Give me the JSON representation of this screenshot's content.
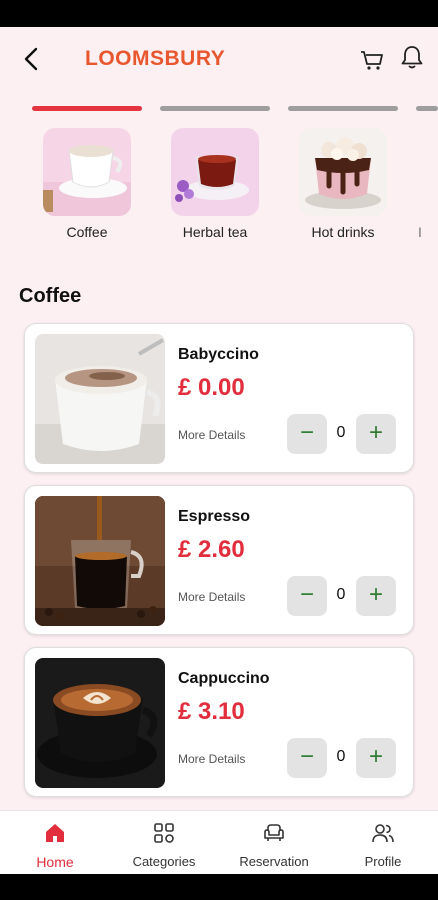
{
  "header": {
    "logo": "LOOMSBURY",
    "back_icon": "chevron-left-icon",
    "cart_icon": "cart-icon",
    "bell_icon": "bell-icon",
    "brand_color": "#e8572f"
  },
  "categories": [
    {
      "label": "Coffee",
      "active": true
    },
    {
      "label": "Herbal tea",
      "active": false
    },
    {
      "label": "Hot drinks",
      "active": false
    }
  ],
  "section": {
    "title": "Coffee"
  },
  "products": [
    {
      "name": "Babyccino",
      "price": "£ 0.00",
      "more": "More Details",
      "qty": "0"
    },
    {
      "name": "Espresso",
      "price": "£ 2.60",
      "more": "More Details",
      "qty": "0"
    },
    {
      "name": "Cappuccino",
      "price": "£ 3.10",
      "more": "More Details",
      "qty": "0"
    }
  ],
  "bottom_nav": [
    {
      "label": "Home",
      "icon": "home-icon",
      "active": true
    },
    {
      "label": "Categories",
      "icon": "grid-icon",
      "active": false
    },
    {
      "label": "Reservation",
      "icon": "armchair-icon",
      "active": false
    },
    {
      "label": "Profile",
      "icon": "users-icon",
      "active": false
    }
  ],
  "colors": {
    "accent": "#e22d3c",
    "background": "#fdf0f3",
    "stepper_icon": "#2e7d32"
  }
}
